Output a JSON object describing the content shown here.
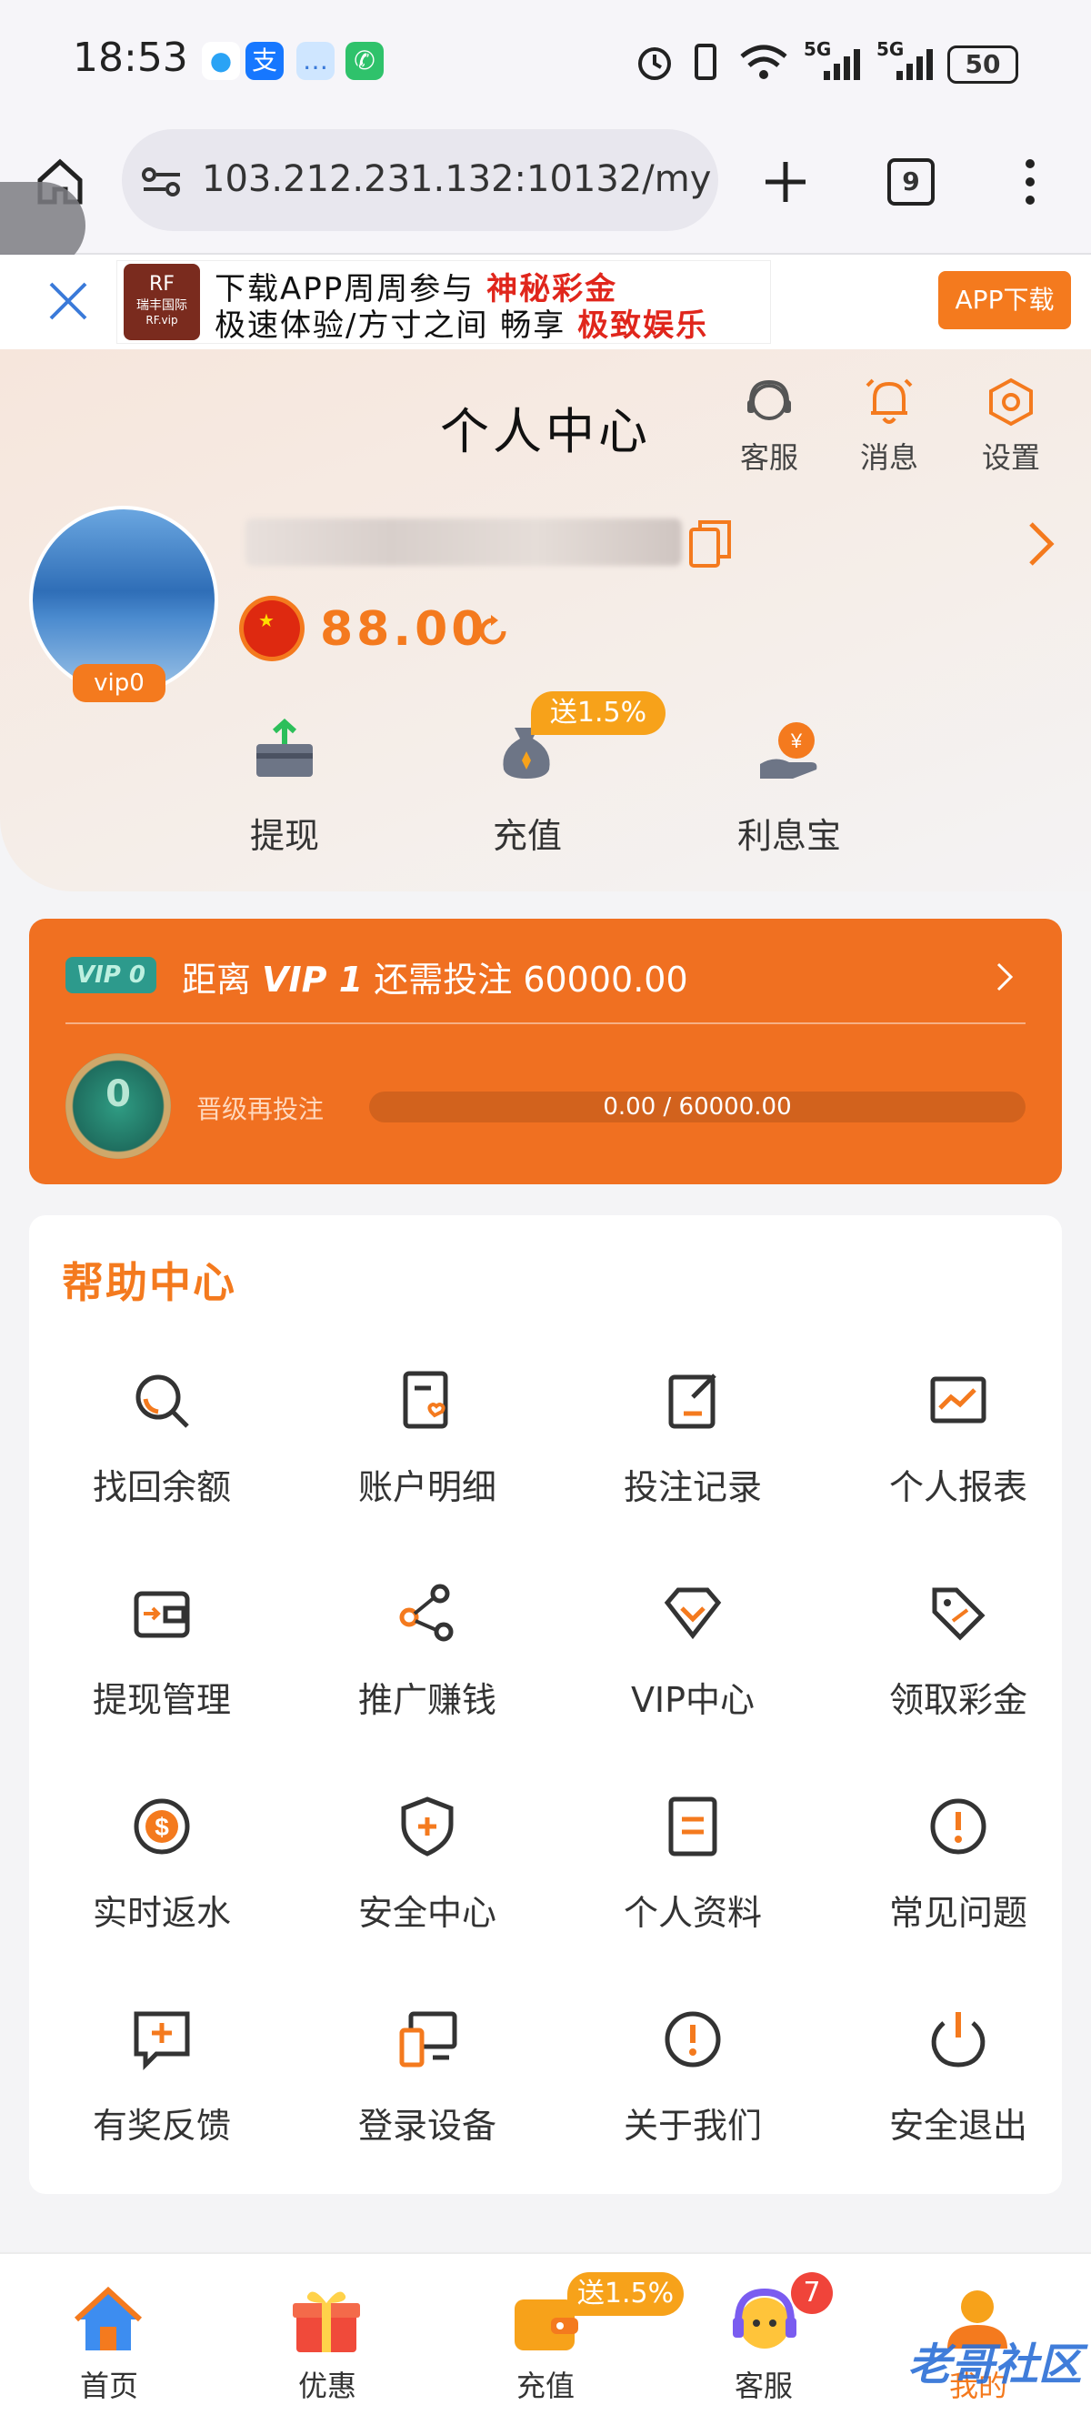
{
  "status_bar": {
    "time": "18:53",
    "battery": "50",
    "network": [
      "5G",
      "5G"
    ]
  },
  "browser": {
    "url": "103.212.231.132:10132/my",
    "tab_count": "9"
  },
  "ad": {
    "logo_text": "瑞丰国际\nRF.vip",
    "line1_prefix": "下载APP周周参与 ",
    "line1_highlight": "神秘彩金",
    "line2_prefix": "极速体验/方寸之间 畅享 ",
    "line2_highlight": "极致娱乐",
    "download_label": "APP下载"
  },
  "header": {
    "title": "个人中心",
    "actions": [
      {
        "label": "客服",
        "icon": "headset-icon"
      },
      {
        "label": "消息",
        "icon": "bell-icon"
      },
      {
        "label": "设置",
        "icon": "hexagon-settings-icon"
      }
    ]
  },
  "profile": {
    "vip_level": "vip0",
    "balance": "88.00"
  },
  "quick_actions": [
    {
      "label": "提现",
      "icon": "withdraw-icon"
    },
    {
      "label": "充值",
      "icon": "money-bag-icon",
      "badge": "送1.5%"
    },
    {
      "label": "利息宝",
      "icon": "interest-hand-icon"
    }
  ],
  "vip_card": {
    "tag": "VIP 0",
    "distance_prefix": "距离 ",
    "next_level": "VIP 1",
    "distance_suffix": " 还需投注 60000.00",
    "medal_level": "0",
    "upgrade_label": "晋级再投注",
    "progress_text": "0.00 / 60000.00",
    "progress": 0
  },
  "help_center": {
    "title": "帮助中心",
    "items": [
      {
        "label": "找回余额",
        "icon": "search-icon"
      },
      {
        "label": "账户明细",
        "icon": "account-detail-icon"
      },
      {
        "label": "投注记录",
        "icon": "edit-record-icon"
      },
      {
        "label": "个人报表",
        "icon": "chart-icon"
      },
      {
        "label": "提现管理",
        "icon": "wallet-icon"
      },
      {
        "label": "推广赚钱",
        "icon": "share-icon"
      },
      {
        "label": "VIP中心",
        "icon": "diamond-icon"
      },
      {
        "label": "领取彩金",
        "icon": "tag-icon"
      },
      {
        "label": "实时返水",
        "icon": "dollar-coin-icon"
      },
      {
        "label": "安全中心",
        "icon": "shield-icon"
      },
      {
        "label": "个人资料",
        "icon": "document-icon"
      },
      {
        "label": "常见问题",
        "icon": "alert-circle-icon"
      },
      {
        "label": "有奖反馈",
        "icon": "feedback-icon"
      },
      {
        "label": "登录设备",
        "icon": "devices-icon"
      },
      {
        "label": "关于我们",
        "icon": "info-icon"
      },
      {
        "label": "安全退出",
        "icon": "power-icon"
      }
    ]
  },
  "bottom_nav": [
    {
      "label": "首页",
      "icon": "home-icon"
    },
    {
      "label": "优惠",
      "icon": "gift-icon"
    },
    {
      "label": "充值",
      "icon": "wallet-icon",
      "badge": "送1.5%"
    },
    {
      "label": "客服",
      "icon": "support-icon",
      "badge": "7"
    },
    {
      "label": "我的",
      "icon": "profile-icon"
    }
  ],
  "watermark": "老哥社区",
  "colors": {
    "accent": "#f47a1e",
    "vip_card": "#f07021",
    "highlight_red": "#e0261c"
  }
}
